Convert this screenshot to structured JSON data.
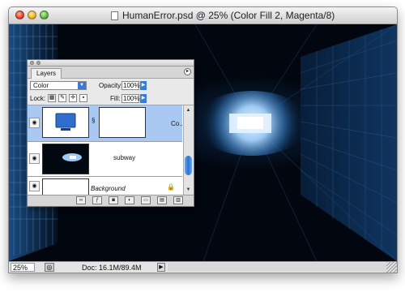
{
  "window": {
    "title": "HumanError.psd @ 25% (Color Fill 2, Magenta/8)"
  },
  "statusbar": {
    "zoom": "25%",
    "doc_size": "Doc: 16.1M/89.4M"
  },
  "layers_panel": {
    "tab_label": "Layers",
    "blend_mode": "Color",
    "opacity_label": "Opacity:",
    "opacity_value": "100%",
    "lock_label": "Lock:",
    "fill_label": "Fill:",
    "fill_value": "100%",
    "layers": [
      {
        "name": "Co...",
        "selected": true
      },
      {
        "name": "subway",
        "selected": false
      },
      {
        "name": "Background",
        "selected": false
      }
    ],
    "bottom_icons": [
      "link-icon",
      "layer-style-icon",
      "mask-icon",
      "adjustment-icon",
      "group-icon",
      "new-layer-icon",
      "trash-icon"
    ]
  },
  "colors": {
    "selection": "#a9c9f2",
    "accent": "#3a7bd5",
    "canvas_dark": "#02060e",
    "tunnel_light": "#d8ecff"
  },
  "icons": [
    "close-button",
    "minimize-button",
    "zoom-button",
    "document-icon",
    "eye-icon",
    "chain-link-icon",
    "lock-icon",
    "panel-menu-icon"
  ]
}
